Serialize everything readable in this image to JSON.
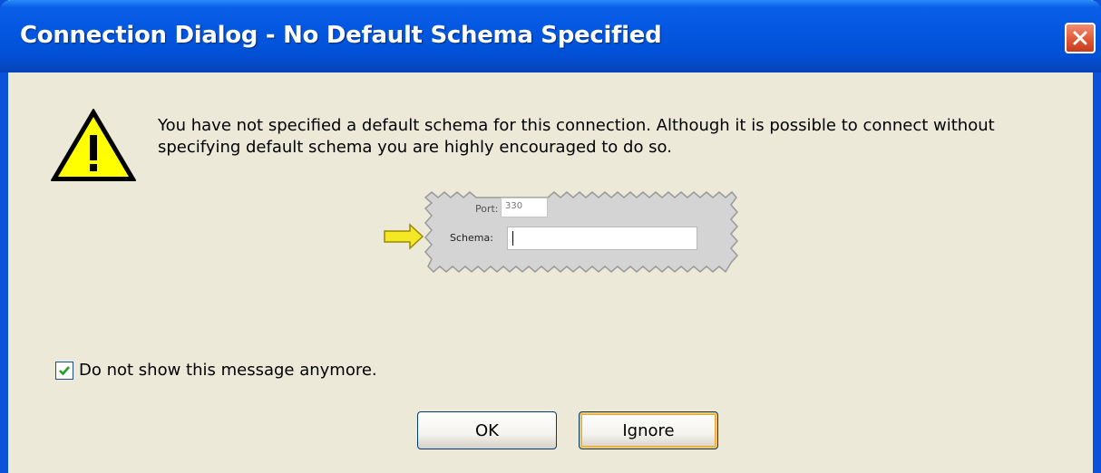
{
  "window": {
    "title": "Connection Dialog - No Default Schema Specified",
    "close_icon": "close-x-icon"
  },
  "icon": {
    "name": "warning-icon"
  },
  "message": {
    "line1": "You have not specified a default schema for this connection. Although it is possible to connect without",
    "line2": "specifying default schema you are highly encouraged to do so."
  },
  "hint_image": {
    "port_label": "Port:",
    "port_value": "330",
    "schema_label": "Schema:",
    "schema_value": ""
  },
  "checkbox": {
    "label": "Do not show this message anymore.",
    "checked": true
  },
  "buttons": {
    "ok": "OK",
    "ignore": "Ignore"
  },
  "colors": {
    "titlebar": "#0a53d8",
    "dialog_bg": "#ece9d8",
    "warning_yellow": "#ffff00",
    "arrow_yellow": "#f4e826",
    "close_red": "#e35c3a"
  }
}
